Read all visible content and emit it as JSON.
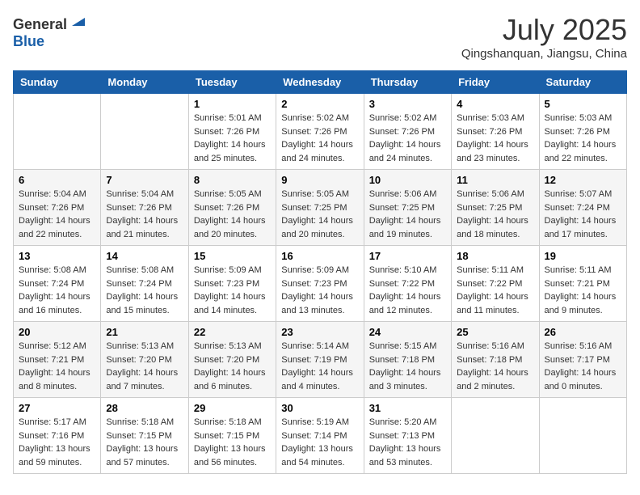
{
  "header": {
    "logo_general": "General",
    "logo_blue": "Blue",
    "month": "July 2025",
    "location": "Qingshanquan, Jiangsu, China"
  },
  "weekdays": [
    "Sunday",
    "Monday",
    "Tuesday",
    "Wednesday",
    "Thursday",
    "Friday",
    "Saturday"
  ],
  "weeks": [
    [
      {
        "day": "",
        "sunrise": "",
        "sunset": "",
        "daylight": ""
      },
      {
        "day": "",
        "sunrise": "",
        "sunset": "",
        "daylight": ""
      },
      {
        "day": "1",
        "sunrise": "Sunrise: 5:01 AM",
        "sunset": "Sunset: 7:26 PM",
        "daylight": "Daylight: 14 hours and 25 minutes."
      },
      {
        "day": "2",
        "sunrise": "Sunrise: 5:02 AM",
        "sunset": "Sunset: 7:26 PM",
        "daylight": "Daylight: 14 hours and 24 minutes."
      },
      {
        "day": "3",
        "sunrise": "Sunrise: 5:02 AM",
        "sunset": "Sunset: 7:26 PM",
        "daylight": "Daylight: 14 hours and 24 minutes."
      },
      {
        "day": "4",
        "sunrise": "Sunrise: 5:03 AM",
        "sunset": "Sunset: 7:26 PM",
        "daylight": "Daylight: 14 hours and 23 minutes."
      },
      {
        "day": "5",
        "sunrise": "Sunrise: 5:03 AM",
        "sunset": "Sunset: 7:26 PM",
        "daylight": "Daylight: 14 hours and 22 minutes."
      }
    ],
    [
      {
        "day": "6",
        "sunrise": "Sunrise: 5:04 AM",
        "sunset": "Sunset: 7:26 PM",
        "daylight": "Daylight: 14 hours and 22 minutes."
      },
      {
        "day": "7",
        "sunrise": "Sunrise: 5:04 AM",
        "sunset": "Sunset: 7:26 PM",
        "daylight": "Daylight: 14 hours and 21 minutes."
      },
      {
        "day": "8",
        "sunrise": "Sunrise: 5:05 AM",
        "sunset": "Sunset: 7:26 PM",
        "daylight": "Daylight: 14 hours and 20 minutes."
      },
      {
        "day": "9",
        "sunrise": "Sunrise: 5:05 AM",
        "sunset": "Sunset: 7:25 PM",
        "daylight": "Daylight: 14 hours and 20 minutes."
      },
      {
        "day": "10",
        "sunrise": "Sunrise: 5:06 AM",
        "sunset": "Sunset: 7:25 PM",
        "daylight": "Daylight: 14 hours and 19 minutes."
      },
      {
        "day": "11",
        "sunrise": "Sunrise: 5:06 AM",
        "sunset": "Sunset: 7:25 PM",
        "daylight": "Daylight: 14 hours and 18 minutes."
      },
      {
        "day": "12",
        "sunrise": "Sunrise: 5:07 AM",
        "sunset": "Sunset: 7:24 PM",
        "daylight": "Daylight: 14 hours and 17 minutes."
      }
    ],
    [
      {
        "day": "13",
        "sunrise": "Sunrise: 5:08 AM",
        "sunset": "Sunset: 7:24 PM",
        "daylight": "Daylight: 14 hours and 16 minutes."
      },
      {
        "day": "14",
        "sunrise": "Sunrise: 5:08 AM",
        "sunset": "Sunset: 7:24 PM",
        "daylight": "Daylight: 14 hours and 15 minutes."
      },
      {
        "day": "15",
        "sunrise": "Sunrise: 5:09 AM",
        "sunset": "Sunset: 7:23 PM",
        "daylight": "Daylight: 14 hours and 14 minutes."
      },
      {
        "day": "16",
        "sunrise": "Sunrise: 5:09 AM",
        "sunset": "Sunset: 7:23 PM",
        "daylight": "Daylight: 14 hours and 13 minutes."
      },
      {
        "day": "17",
        "sunrise": "Sunrise: 5:10 AM",
        "sunset": "Sunset: 7:22 PM",
        "daylight": "Daylight: 14 hours and 12 minutes."
      },
      {
        "day": "18",
        "sunrise": "Sunrise: 5:11 AM",
        "sunset": "Sunset: 7:22 PM",
        "daylight": "Daylight: 14 hours and 11 minutes."
      },
      {
        "day": "19",
        "sunrise": "Sunrise: 5:11 AM",
        "sunset": "Sunset: 7:21 PM",
        "daylight": "Daylight: 14 hours and 9 minutes."
      }
    ],
    [
      {
        "day": "20",
        "sunrise": "Sunrise: 5:12 AM",
        "sunset": "Sunset: 7:21 PM",
        "daylight": "Daylight: 14 hours and 8 minutes."
      },
      {
        "day": "21",
        "sunrise": "Sunrise: 5:13 AM",
        "sunset": "Sunset: 7:20 PM",
        "daylight": "Daylight: 14 hours and 7 minutes."
      },
      {
        "day": "22",
        "sunrise": "Sunrise: 5:13 AM",
        "sunset": "Sunset: 7:20 PM",
        "daylight": "Daylight: 14 hours and 6 minutes."
      },
      {
        "day": "23",
        "sunrise": "Sunrise: 5:14 AM",
        "sunset": "Sunset: 7:19 PM",
        "daylight": "Daylight: 14 hours and 4 minutes."
      },
      {
        "day": "24",
        "sunrise": "Sunrise: 5:15 AM",
        "sunset": "Sunset: 7:18 PM",
        "daylight": "Daylight: 14 hours and 3 minutes."
      },
      {
        "day": "25",
        "sunrise": "Sunrise: 5:16 AM",
        "sunset": "Sunset: 7:18 PM",
        "daylight": "Daylight: 14 hours and 2 minutes."
      },
      {
        "day": "26",
        "sunrise": "Sunrise: 5:16 AM",
        "sunset": "Sunset: 7:17 PM",
        "daylight": "Daylight: 14 hours and 0 minutes."
      }
    ],
    [
      {
        "day": "27",
        "sunrise": "Sunrise: 5:17 AM",
        "sunset": "Sunset: 7:16 PM",
        "daylight": "Daylight: 13 hours and 59 minutes."
      },
      {
        "day": "28",
        "sunrise": "Sunrise: 5:18 AM",
        "sunset": "Sunset: 7:15 PM",
        "daylight": "Daylight: 13 hours and 57 minutes."
      },
      {
        "day": "29",
        "sunrise": "Sunrise: 5:18 AM",
        "sunset": "Sunset: 7:15 PM",
        "daylight": "Daylight: 13 hours and 56 minutes."
      },
      {
        "day": "30",
        "sunrise": "Sunrise: 5:19 AM",
        "sunset": "Sunset: 7:14 PM",
        "daylight": "Daylight: 13 hours and 54 minutes."
      },
      {
        "day": "31",
        "sunrise": "Sunrise: 5:20 AM",
        "sunset": "Sunset: 7:13 PM",
        "daylight": "Daylight: 13 hours and 53 minutes."
      },
      {
        "day": "",
        "sunrise": "",
        "sunset": "",
        "daylight": ""
      },
      {
        "day": "",
        "sunrise": "",
        "sunset": "",
        "daylight": ""
      }
    ]
  ]
}
